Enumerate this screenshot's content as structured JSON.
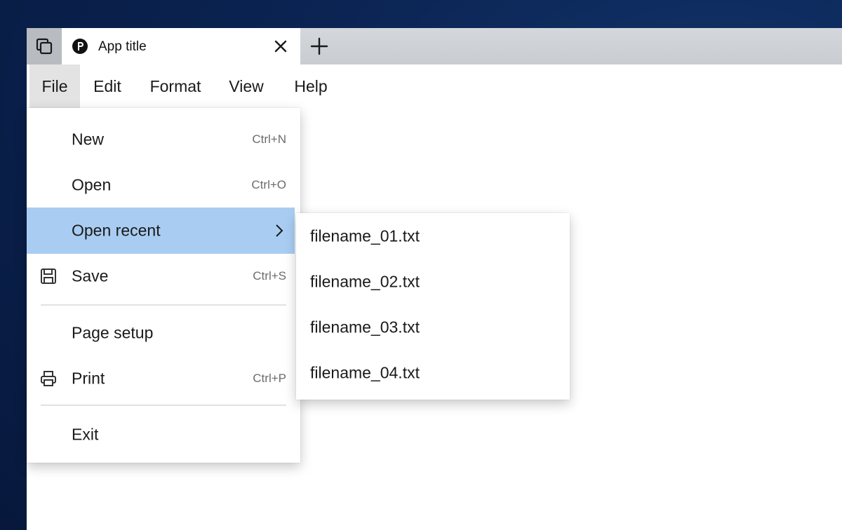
{
  "tab": {
    "title": "App title"
  },
  "menubar": {
    "items": [
      {
        "label": "File"
      },
      {
        "label": "Edit"
      },
      {
        "label": "Format"
      },
      {
        "label": "View"
      },
      {
        "label": "Help"
      }
    ]
  },
  "file_menu": {
    "items": [
      {
        "label": "New",
        "shortcut": "Ctrl+N"
      },
      {
        "label": "Open",
        "shortcut": "Ctrl+O"
      },
      {
        "label": "Open recent",
        "shortcut": ""
      },
      {
        "label": "Save",
        "shortcut": "Ctrl+S",
        "icon": "save-icon"
      },
      {
        "label": "Page setup",
        "shortcut": ""
      },
      {
        "label": "Print",
        "shortcut": "Ctrl+P",
        "icon": "printer-icon"
      },
      {
        "label": "Exit",
        "shortcut": ""
      }
    ]
  },
  "recent_menu": {
    "items": [
      {
        "label": "filename_01.txt"
      },
      {
        "label": "filename_02.txt"
      },
      {
        "label": "filename_03.txt"
      },
      {
        "label": "filename_04.txt"
      }
    ]
  },
  "colors": {
    "highlight": "#a9cdf2",
    "active_menu": "#e3e3e3",
    "tabbar": "#c9ccd0",
    "desktop": "#0b2453"
  }
}
